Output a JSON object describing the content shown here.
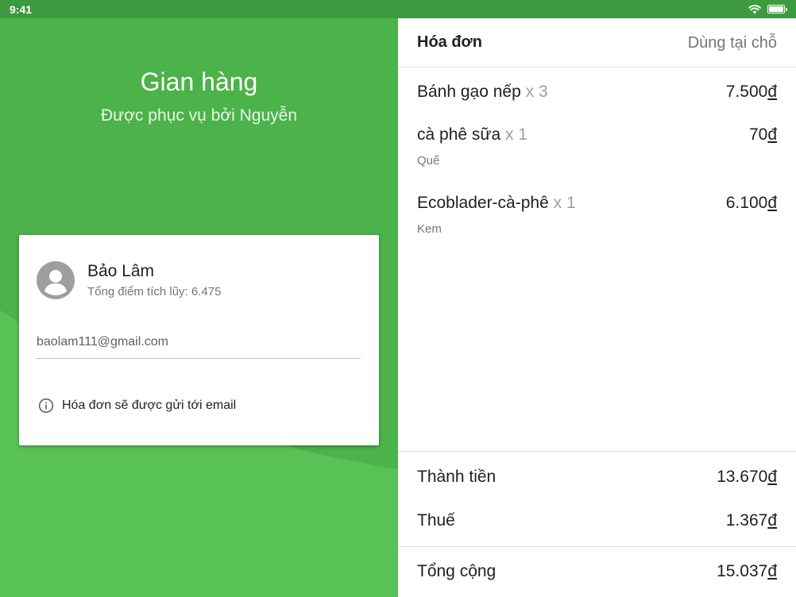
{
  "status_bar": {
    "time": "9:41"
  },
  "store": {
    "title": "Gian hàng",
    "subtitle": "Được phục vụ bởi Nguyễn"
  },
  "customer": {
    "name": "Bảo Lâm",
    "points_text": "Tổng điểm tích lũy: 6.475",
    "email_value": "baolam111@gmail.com",
    "info_text": "Hóa đơn sẽ được gửi tới email"
  },
  "bill": {
    "title": "Hóa đơn",
    "mode": "Dùng tại chỗ",
    "items": [
      {
        "name": "Bánh gạo nếp",
        "qty": "x 3",
        "price": "7.500",
        "note": ""
      },
      {
        "name": "cà phê sữa",
        "qty": "x 1",
        "price": "70",
        "note": "Quế"
      },
      {
        "name": "Ecoblader-cà-phê",
        "qty": "x 1",
        "price": "6.100",
        "note": "Kem"
      }
    ],
    "currency": "đ",
    "subtotal_label": "Thành tiền",
    "subtotal": "13.670",
    "tax_label": "Thuế",
    "tax": "1.367",
    "total_label": "Tổng cộng",
    "total": "15.037"
  },
  "colors": {
    "brand_green": "#4cb24a",
    "status_bar_green": "#3d9a3f"
  }
}
